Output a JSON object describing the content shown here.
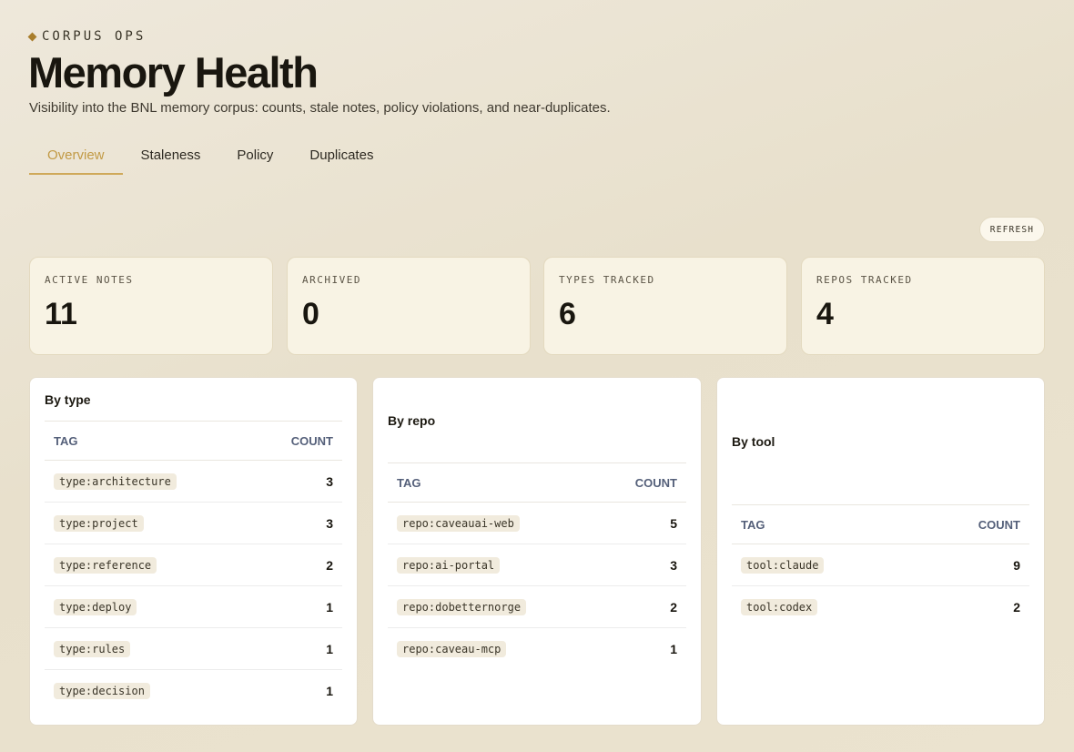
{
  "header": {
    "eyebrow": "CORPUS OPS",
    "title": "Memory Health",
    "subtitle": "Visibility into the BNL memory corpus: counts, stale notes, policy violations, and near-duplicates."
  },
  "tabs": [
    {
      "label": "Overview",
      "active": true
    },
    {
      "label": "Staleness",
      "active": false
    },
    {
      "label": "Policy",
      "active": false
    },
    {
      "label": "Duplicates",
      "active": false
    }
  ],
  "refresh_label": "REFRESH",
  "stats": [
    {
      "label": "ACTIVE NOTES",
      "value": "11"
    },
    {
      "label": "ARCHIVED",
      "value": "0"
    },
    {
      "label": "TYPES TRACKED",
      "value": "6"
    },
    {
      "label": "REPOS TRACKED",
      "value": "4"
    }
  ],
  "panels": [
    {
      "title": "By type",
      "col_tag": "TAG",
      "col_count": "COUNT",
      "rows": [
        {
          "tag": "type:architecture",
          "count": "3"
        },
        {
          "tag": "type:project",
          "count": "3"
        },
        {
          "tag": "type:reference",
          "count": "2"
        },
        {
          "tag": "type:deploy",
          "count": "1"
        },
        {
          "tag": "type:rules",
          "count": "1"
        },
        {
          "tag": "type:decision",
          "count": "1"
        }
      ]
    },
    {
      "title": "By repo",
      "col_tag": "TAG",
      "col_count": "COUNT",
      "rows": [
        {
          "tag": "repo:caveauai-web",
          "count": "5"
        },
        {
          "tag": "repo:ai-portal",
          "count": "3"
        },
        {
          "tag": "repo:dobetternorge",
          "count": "2"
        },
        {
          "tag": "repo:caveau-mcp",
          "count": "1"
        }
      ]
    },
    {
      "title": "By tool",
      "col_tag": "TAG",
      "col_count": "COUNT",
      "rows": [
        {
          "tag": "tool:claude",
          "count": "9"
        },
        {
          "tag": "tool:codex",
          "count": "2"
        }
      ]
    }
  ],
  "colors": {
    "accent": "#cfa95a",
    "accent_text": "#c29a45",
    "stat_card_bg": "#f8f3e4",
    "chip_bg": "#f1ebdd"
  }
}
